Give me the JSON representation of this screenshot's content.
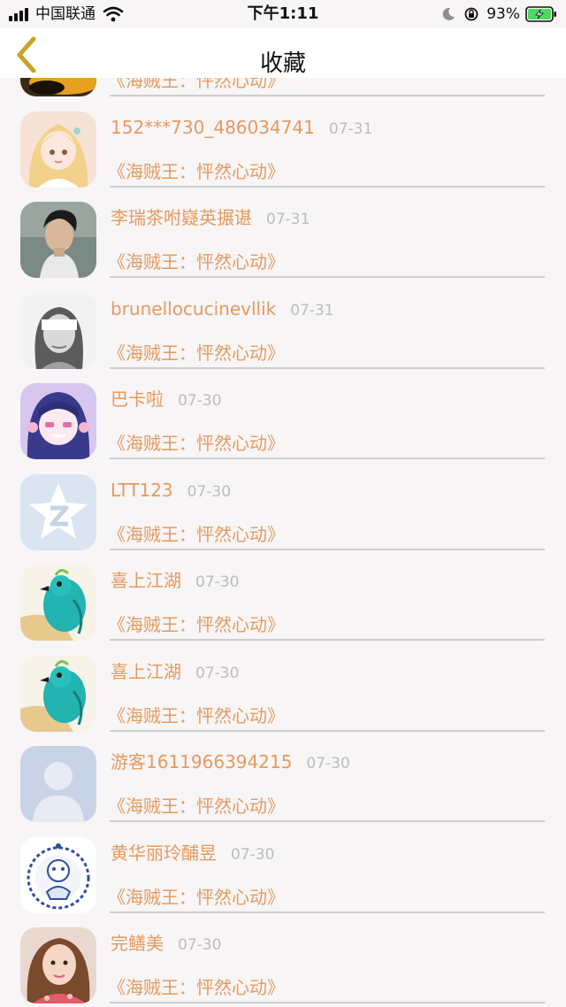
{
  "status_bar": {
    "carrier": "中国联通",
    "time": "下午1:11",
    "battery": "93%",
    "icons": [
      "signal-icon",
      "wifi-icon",
      "moon-icon",
      "rotation-lock-icon",
      "battery-charging-icon"
    ]
  },
  "nav": {
    "title": "收藏",
    "back_icon": "chevron-left-icon"
  },
  "list": {
    "items": [
      {
        "name": "",
        "date": "",
        "title": "《海贼王：怦然心动》",
        "avatar": "avatar-partial"
      },
      {
        "name": "152***730_486034741",
        "date": "07-31",
        "title": "《海贼王：怦然心动》",
        "avatar": "anime-blonde-girl"
      },
      {
        "name": "李瑞茶咐嶷英搌谌",
        "date": "07-31",
        "title": "《海贼王：怦然心动》",
        "avatar": "young-man-photo"
      },
      {
        "name": "brunellocucinevllik",
        "date": "07-31",
        "title": "《海贼王：怦然心动》",
        "avatar": "blindfolded-girl-bw"
      },
      {
        "name": "巴卡啦",
        "date": "07-30",
        "title": "《海贼王：怦然心动》",
        "avatar": "anime-purple-girl"
      },
      {
        "name": "LTT123",
        "date": "07-30",
        "title": "《海贼王：怦然心动》",
        "avatar": "qq-star-default"
      },
      {
        "name": "喜上江湖",
        "date": "07-30",
        "title": "《海贼王：怦然心动》",
        "avatar": "teal-parrot"
      },
      {
        "name": "喜上江湖",
        "date": "07-30",
        "title": "《海贼王：怦然心动》",
        "avatar": "teal-parrot"
      },
      {
        "name": "游客1611966394215",
        "date": "07-30",
        "title": "《海贼王：怦然心动》",
        "avatar": "default-person"
      },
      {
        "name": "黄华丽玲酺昱",
        "date": "07-30",
        "title": "《海贼王：怦然心动》",
        "avatar": "porcelain-plate"
      },
      {
        "name": "完鳝美",
        "date": "07-30",
        "title": "《海贼王：怦然心动》",
        "avatar": "woman-selfie"
      }
    ]
  },
  "colors": {
    "accent": "#e59a5f",
    "date": "#bdbdbd",
    "background": "#f7f5f6",
    "divider": "#cfcfcf",
    "back_arrow": "#c9a227",
    "battery_fill": "#4cd964"
  }
}
